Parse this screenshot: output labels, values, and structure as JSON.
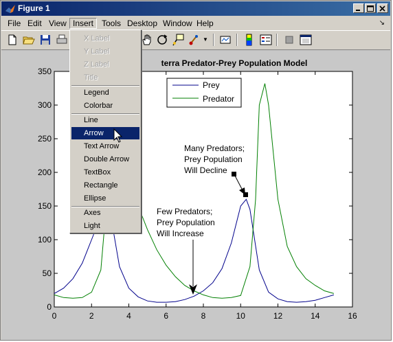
{
  "window": {
    "title": "Figure 1"
  },
  "menubar": {
    "items": [
      {
        "label": "File"
      },
      {
        "label": "Edit"
      },
      {
        "label": "View"
      },
      {
        "label": "Insert"
      },
      {
        "label": "Tools"
      },
      {
        "label": "Desktop"
      },
      {
        "label": "Window"
      },
      {
        "label": "Help"
      }
    ],
    "overflow_arrow": "↘"
  },
  "insert_menu": {
    "items": [
      {
        "label": "X Label"
      },
      {
        "label": "Y Label"
      },
      {
        "label": "Z Label"
      },
      {
        "label": "Title"
      },
      {
        "label": "Legend"
      },
      {
        "label": "Colorbar"
      },
      {
        "label": "Line"
      },
      {
        "label": "Arrow"
      },
      {
        "label": "Text Arrow"
      },
      {
        "label": "Double Arrow"
      },
      {
        "label": "TextBox"
      },
      {
        "label": "Rectangle"
      },
      {
        "label": "Ellipse"
      },
      {
        "label": "Axes"
      },
      {
        "label": "Light"
      }
    ]
  },
  "chart_data": {
    "type": "line",
    "title": "terra Predator-Prey Population Model",
    "xlim": [
      0,
      16
    ],
    "ylim": [
      0,
      350
    ],
    "xticks": [
      "0",
      "2",
      "4",
      "6",
      "8",
      "10",
      "12",
      "14",
      "16"
    ],
    "yticks": [
      "0",
      "50",
      "100",
      "150",
      "200",
      "250",
      "300",
      "350"
    ],
    "legend": {
      "placement": "top-center",
      "entries": [
        "Prey",
        "Predator"
      ]
    },
    "colors": {
      "prey": "#00008b",
      "predator": "#007f00"
    },
    "series": [
      {
        "name": "Prey",
        "x": [
          0,
          0.5,
          1,
          1.5,
          2,
          2.5,
          3,
          3.5,
          4,
          4.5,
          5,
          5.5,
          6,
          6.5,
          7,
          7.5,
          8,
          8.5,
          9,
          9.5,
          10,
          10.3,
          10.5,
          11,
          11.5,
          12,
          12.5,
          13,
          13.5,
          14,
          14.5,
          15
        ],
        "y": [
          20,
          28,
          42,
          65,
          100,
          135,
          140,
          60,
          28,
          15,
          9,
          7,
          7,
          8,
          11,
          16,
          24,
          36,
          57,
          95,
          150,
          160,
          145,
          55,
          22,
          12,
          8,
          7,
          8,
          10,
          14,
          18
        ]
      },
      {
        "name": "Predator",
        "x": [
          0,
          0.5,
          1,
          1.5,
          2,
          2.5,
          2.7,
          3,
          3.2,
          3.5,
          4,
          4.5,
          5,
          5.5,
          6,
          6.5,
          7,
          7.5,
          8,
          8.5,
          9,
          9.5,
          10,
          10.5,
          10.8,
          11,
          11.3,
          11.5,
          12,
          12.5,
          13,
          13.5,
          14,
          14.5,
          15
        ],
        "y": [
          18,
          14,
          13,
          14,
          22,
          55,
          120,
          185,
          205,
          200,
          185,
          150,
          115,
          85,
          62,
          45,
          32,
          24,
          18,
          14,
          13,
          14,
          17,
          60,
          160,
          300,
          332,
          300,
          160,
          90,
          60,
          42,
          32,
          24,
          20
        ]
      }
    ],
    "annotations": [
      {
        "lines": [
          "Many Predators;",
          "Prey Population",
          "Will Decline"
        ],
        "arrow_to": [
          10.3,
          165
        ]
      },
      {
        "lines": [
          "Few Predators;",
          "Prey Population",
          "Will Increase"
        ],
        "arrow_to": [
          7.5,
          18
        ]
      }
    ]
  }
}
